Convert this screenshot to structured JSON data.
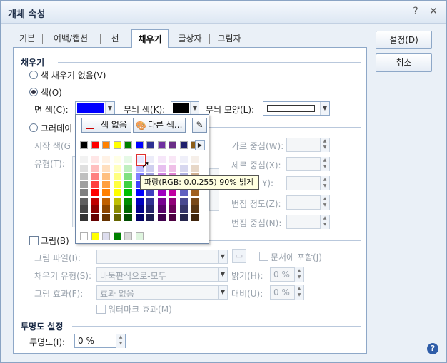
{
  "window": {
    "title": "개체 속성",
    "help_label": "?",
    "close_label": "✕"
  },
  "tabs": [
    "기본",
    "여백/캡션",
    "선",
    "채우기",
    "글상자",
    "그림자"
  ],
  "buttons": {
    "ok": "설정(D)",
    "cancel": "취소"
  },
  "fill": {
    "section_title": "채우기",
    "no_fill": "색 채우기 없음(V)",
    "color": "색(O)",
    "face_color_label": "면 색(C):",
    "face_color": "#0000ff",
    "pattern_color_label": "무늬 색(K):",
    "pattern_color": "#000000",
    "pattern_shape_label": "무늬 모양(L):",
    "gradient": "그러데이",
    "start_color_label": "시작 색(G",
    "type_label": "유형(T):",
    "h_center_label": "가로 중심(W):",
    "v_center_label": "세로 중심(X):",
    "angle_label": "Y):",
    "blur_label": "번짐 정도(Z):",
    "blur_center_label": "번짐 중심(N):"
  },
  "picture": {
    "label": "그림(B)",
    "file_label": "그림 파일(I):",
    "embed_label": "문서에 포함(J)",
    "fill_type_label": "채우기 유형(S):",
    "fill_type_value": "바둑판식으로-모두",
    "brightness_label": "밝기(H):",
    "brightness_value": "0 %",
    "effect_label": "그림 효과(F):",
    "effect_value": "효과 없음",
    "contrast_label": "대비(U):",
    "contrast_value": "0 %",
    "watermark_label": "워터마크 효과(M)"
  },
  "transparency": {
    "section_title": "투명도 설정",
    "label": "투명도(I):",
    "value": "0 %"
  },
  "color_popup": {
    "no_color_label": "색 없음",
    "other_color_label": "다른 색...",
    "theme_colors": [
      "#000000",
      "#ff0000",
      "#ff8000",
      "#ffff00",
      "#008000",
      "#0000ff",
      "#2e3192",
      "#7030a0",
      "#6b2f87",
      "#1f1f6b",
      "#8b5e1a"
    ],
    "recent_colors": [
      "#ffffff",
      "#ffff00",
      "#ddddee",
      "#008000",
      "#d8d8d8",
      "#dff5df"
    ],
    "tooltip": "파랑(RGB: 0,0,255) 90% 밝게"
  }
}
